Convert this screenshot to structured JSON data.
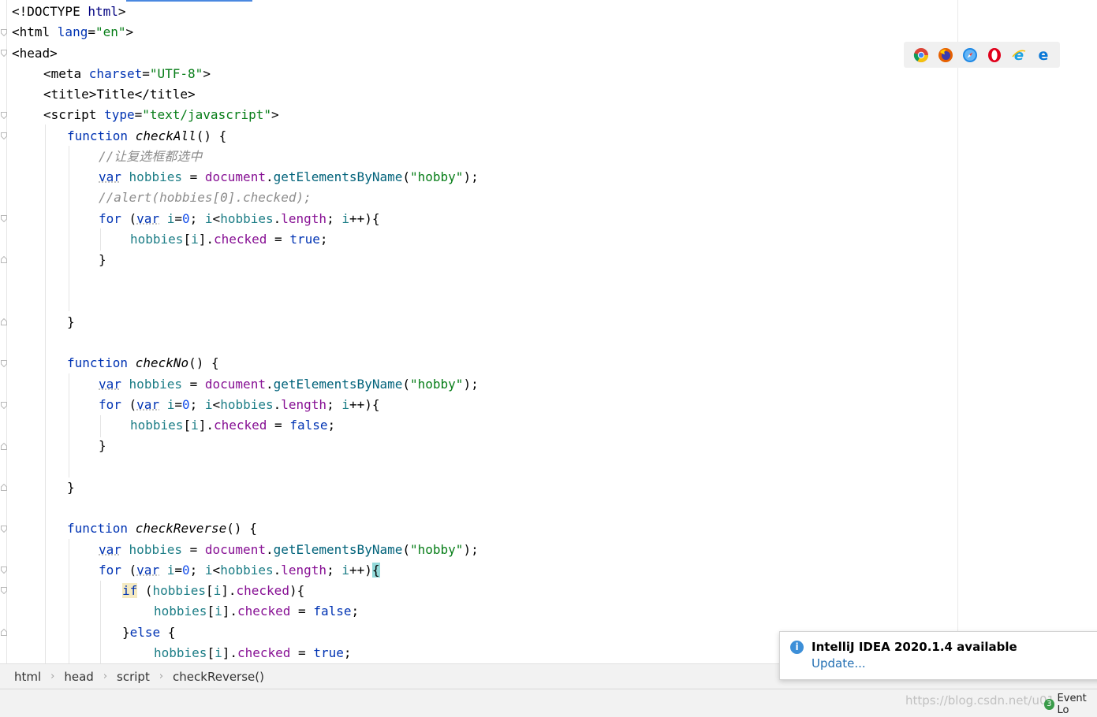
{
  "editor": {
    "lines": {
      "l1": {
        "a": "<!DOCTYPE ",
        "b": "html",
        "c": ">"
      },
      "l2": {
        "a": "<html ",
        "b": "lang",
        "c": "=",
        "d": "\"en\"",
        "e": ">"
      },
      "l3": {
        "a": "<head>"
      },
      "l4": {
        "a": "<meta ",
        "b": "charset",
        "c": "=",
        "d": "\"UTF-8\"",
        "e": ">"
      },
      "l5": {
        "a": "<title>",
        "b": "Title",
        "c": "</title>"
      },
      "l6": {
        "a": "<script ",
        "b": "type",
        "c": "=",
        "d": "\"text/javascript\"",
        "e": ">"
      },
      "l7": {
        "kw": "function ",
        "fn": "checkAll",
        "rest": "() {"
      },
      "l8": {
        "cmt": "//让复选框都选中"
      },
      "l9": {
        "kw": "var",
        "sp": " ",
        "v": "hobbies",
        "eq": " = ",
        "g": "document",
        "dot": ".",
        "m": "getElementsByName",
        "p1": "(",
        "s": "\"hobby\"",
        "p2": ");"
      },
      "l10": {
        "cmt": "//alert(hobbies[0].checked);"
      },
      "l11": {
        "kw": "for",
        "a": " (",
        "kw2": "var",
        "b": " ",
        "i": "i",
        "c": "=",
        "n": "0",
        "d": "; ",
        "i2": "i",
        "e": "<",
        "v": "hobbies",
        "f": ".",
        "p": "length",
        "g": "; ",
        "i3": "i",
        "h": "++){"
      },
      "l12": {
        "v": "hobbies",
        "a": "[",
        "i": "i",
        "b": "].",
        "p": "checked",
        "c": " = ",
        "kw": "true",
        "d": ";"
      },
      "l13": {
        "a": "}"
      },
      "l16": {
        "a": "}"
      },
      "l18": {
        "kw": "function ",
        "fn": "checkNo",
        "rest": "() {"
      },
      "l19": {
        "kw": "var",
        "sp": " ",
        "v": "hobbies",
        "eq": " = ",
        "g": "document",
        "dot": ".",
        "m": "getElementsByName",
        "p1": "(",
        "s": "\"hobby\"",
        "p2": ");"
      },
      "l20": {
        "kw": "for",
        "a": " (",
        "kw2": "var",
        "b": " ",
        "i": "i",
        "c": "=",
        "n": "0",
        "d": "; ",
        "i2": "i",
        "e": "<",
        "v": "hobbies",
        "f": ".",
        "p": "length",
        "g": "; ",
        "i3": "i",
        "h": "++){"
      },
      "l21": {
        "v": "hobbies",
        "a": "[",
        "i": "i",
        "b": "].",
        "p": "checked",
        "c": " = ",
        "kw": "false",
        "d": ";"
      },
      "l22": {
        "a": "}"
      },
      "l24": {
        "a": "}"
      },
      "l26": {
        "kw": "function ",
        "fn": "checkReverse",
        "rest": "() {"
      },
      "l27": {
        "kw": "var",
        "sp": " ",
        "v": "hobbies",
        "eq": " = ",
        "g": "document",
        "dot": ".",
        "m": "getElementsByName",
        "p1": "(",
        "s": "\"hobby\"",
        "p2": ");"
      },
      "l28": {
        "kw": "for",
        "a": " (",
        "kw2": "var",
        "b": " ",
        "i": "i",
        "c": "=",
        "n": "0",
        "d": "; ",
        "i2": "i",
        "e": "<",
        "v": "hobbies",
        "f": ".",
        "p": "length",
        "g": "; ",
        "i3": "i",
        "h": "++)",
        "brace": "{"
      },
      "l29": {
        "kw": "if",
        "a": " (",
        "v": "hobbies",
        "b": "[",
        "i": "i",
        "c": "].",
        "p": "checked",
        "d": "){"
      },
      "l30": {
        "v": "hobbies",
        "a": "[",
        "i": "i",
        "b": "].",
        "p": "checked",
        "c": " = ",
        "kw": "false",
        "d": ";"
      },
      "l31": {
        "a": "}",
        "kw": "else",
        "b": " {"
      },
      "l32": {
        "v": "hobbies",
        "a": "[",
        "i": "i",
        "b": "].",
        "p": "checked",
        "c": " = ",
        "kw": "true",
        "d": ";"
      }
    }
  },
  "browser_icons": [
    "chrome-icon",
    "firefox-icon",
    "safari-icon",
    "opera-icon",
    "ie-icon",
    "edge-icon"
  ],
  "breadcrumb": {
    "items": [
      "html",
      "head",
      "script",
      "checkReverse()"
    ],
    "sep": "›"
  },
  "notification": {
    "title": "IntelliJ IDEA 2020.1.4 available",
    "link": "Update..."
  },
  "statusbar": {
    "watermark": "https://blog.csdn.net/u01",
    "event_log": "Event Lo",
    "event_count": "3"
  },
  "colors": {
    "accent": "#4a88e0",
    "keyword": "#0033b3",
    "string": "#067d17",
    "variable": "#1c7d86",
    "property": "#871094",
    "method": "#00627a",
    "comment": "#8c8c8c"
  }
}
